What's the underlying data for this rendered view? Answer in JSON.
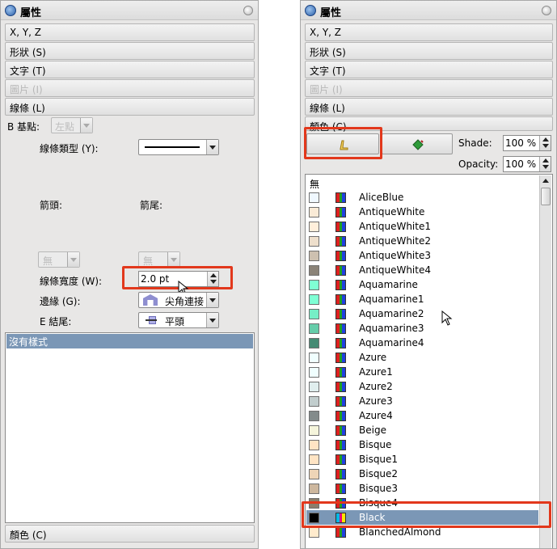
{
  "left": {
    "title": "屬性",
    "sections": {
      "xyz": "X, Y, Z",
      "shape": "形狀 (S)",
      "text": "文字 (T)",
      "image": "圖片 (I)",
      "line": "線條 (L)",
      "color": "顏色 (C)"
    },
    "basepoint_label": "B 基點:",
    "basepoint_value": "左點",
    "line_type_label": "線條類型 (Y):",
    "arrow_start_label": "箭頭:",
    "arrow_end_label": "箭尾:",
    "arrow_start_value": "無",
    "arrow_end_value": "無",
    "line_width_label": "線條寬度 (W):",
    "line_width_value": "2.0 pt",
    "edge_label": "邊緣 (G):",
    "edge_value": "尖角連接",
    "end_label": "E 結尾:",
    "end_value": "平頭",
    "style_item": "沒有樣式"
  },
  "right": {
    "title": "屬性",
    "sections": {
      "xyz": "X, Y, Z",
      "shape": "形狀 (S)",
      "text": "文字 (T)",
      "image": "圖片 (I)",
      "line": "線條 (L)",
      "color": "顏色 (C)"
    },
    "shade_label": "Shade:",
    "shade_value": "100 %",
    "opacity_label": "Opacity:",
    "opacity_value": "100 %",
    "none_label": "無",
    "colors": [
      {
        "name": "AliceBlue",
        "hex": "#f0f8ff"
      },
      {
        "name": "AntiqueWhite",
        "hex": "#faebd7"
      },
      {
        "name": "AntiqueWhite1",
        "hex": "#ffefdb"
      },
      {
        "name": "AntiqueWhite2",
        "hex": "#eedfcc"
      },
      {
        "name": "AntiqueWhite3",
        "hex": "#cdc0b0"
      },
      {
        "name": "AntiqueWhite4",
        "hex": "#8b8378"
      },
      {
        "name": "Aquamarine",
        "hex": "#7fffd4"
      },
      {
        "name": "Aquamarine1",
        "hex": "#7fffd4"
      },
      {
        "name": "Aquamarine2",
        "hex": "#76eec6"
      },
      {
        "name": "Aquamarine3",
        "hex": "#66cdaa"
      },
      {
        "name": "Aquamarine4",
        "hex": "#458b74"
      },
      {
        "name": "Azure",
        "hex": "#f0ffff"
      },
      {
        "name": "Azure1",
        "hex": "#f0ffff"
      },
      {
        "name": "Azure2",
        "hex": "#e0eeee"
      },
      {
        "name": "Azure3",
        "hex": "#c1cdcd"
      },
      {
        "name": "Azure4",
        "hex": "#838b8b"
      },
      {
        "name": "Beige",
        "hex": "#f5f5dc"
      },
      {
        "name": "Bisque",
        "hex": "#ffe4c4"
      },
      {
        "name": "Bisque1",
        "hex": "#ffe4c4"
      },
      {
        "name": "Bisque2",
        "hex": "#eed5b7"
      },
      {
        "name": "Bisque3",
        "hex": "#cdb79e"
      },
      {
        "name": "Bisque4",
        "hex": "#8b7d6b"
      },
      {
        "name": "Black",
        "hex": "#000000",
        "selected": true
      },
      {
        "name": "BlanchedAlmond",
        "hex": "#ffebcd"
      }
    ]
  },
  "colors": {
    "selection": "#7b97b6",
    "highlight_box": "#e2381c",
    "panel_bg": "#e8e7e6"
  }
}
